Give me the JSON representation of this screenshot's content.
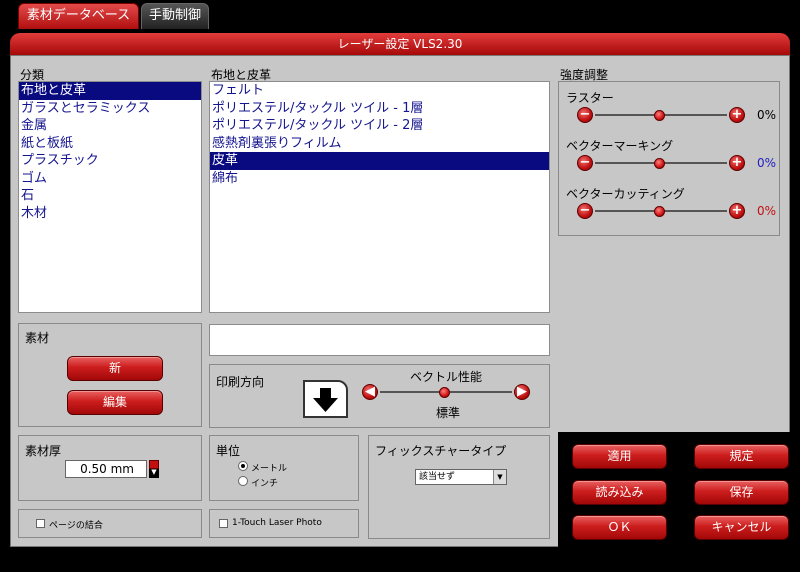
{
  "tabs": [
    {
      "label": "素材データベース",
      "active": true
    },
    {
      "label": "手動制御",
      "active": false
    }
  ],
  "window_title": "レーザー設定 VLS2.30",
  "category": {
    "header": "分類",
    "items": [
      "布地と皮革",
      "ガラスとセラミックス",
      "金属",
      "紙と板紙",
      "プラスチック",
      "ゴム",
      "石",
      "木材"
    ],
    "selected_index": 0
  },
  "materials": {
    "header": "布地と皮革",
    "items": [
      "フェルト",
      "ポリエステル/タックル ツイル - 1層",
      "ポリエステル/タックル ツイル - 2層",
      "感熱剤裏張りフィルム",
      "皮革",
      "綿布"
    ],
    "selected_index": 4
  },
  "intensity": {
    "header": "強度調整",
    "sliders": [
      {
        "label": "ラスター",
        "value": "0%",
        "color": "#000000"
      },
      {
        "label": "ベクターマーキング",
        "value": "0%",
        "color": "#2020c0"
      },
      {
        "label": "ベクターカッティング",
        "value": "0%",
        "color": "#c01010"
      }
    ]
  },
  "material_group": {
    "header": "素材",
    "new_label": "新",
    "edit_label": "編集"
  },
  "print_direction": {
    "header": "印刷方向",
    "vector_perf_label": "ベクトル性能",
    "vector_perf_value": "標準"
  },
  "thickness": {
    "header": "素材厚",
    "value": "0.50 mm"
  },
  "units": {
    "header": "単位",
    "options": [
      "メートル",
      "インチ"
    ],
    "selected_index": 0
  },
  "fixture": {
    "header": "フィックスチャータイプ",
    "selected": "該当せず"
  },
  "page_merge_label": "ページの結合",
  "one_touch_label": "1-Touch Laser Photo",
  "actions": {
    "apply": "適用",
    "default": "規定",
    "load": "読み込み",
    "save": "保存",
    "ok": "ＯＫ",
    "cancel": "キャンセル"
  }
}
